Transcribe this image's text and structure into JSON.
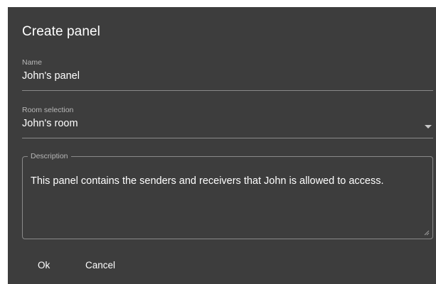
{
  "dialog": {
    "title": "Create panel"
  },
  "name_field": {
    "label": "Name",
    "value": "John's panel"
  },
  "room_field": {
    "label": "Room selection",
    "value": "John's room",
    "icon": "dropdown-caret-icon"
  },
  "description_field": {
    "label": "Description",
    "value": "This panel contains the senders and receivers that John is allowed to access.",
    "icon": "resize-handle-icon"
  },
  "actions": {
    "ok_label": "Ok",
    "cancel_label": "Cancel"
  },
  "colors": {
    "dialog_background": "#3d3d3d",
    "text": "#ffffff",
    "label_text": "#b8b8b8",
    "border": "#8a8a8a"
  }
}
